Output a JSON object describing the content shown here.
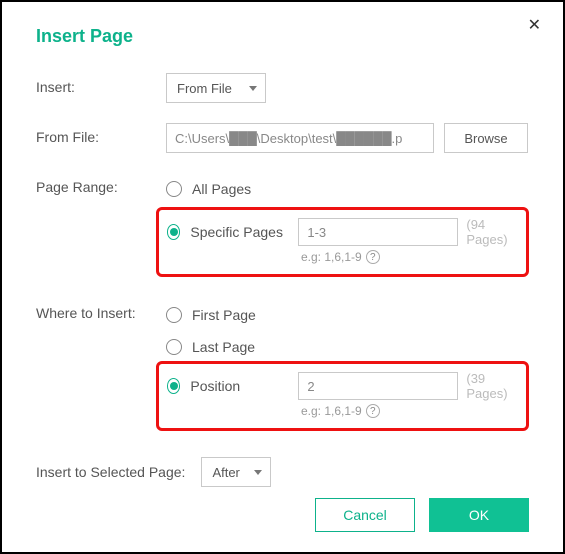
{
  "dialog": {
    "title": "Insert Page",
    "close": "✕"
  },
  "insert": {
    "label": "Insert:",
    "value": "From File"
  },
  "from_file": {
    "label": "From File:",
    "path": "C:\\Users\\███\\Desktop\\test\\██████.p",
    "browse": "Browse"
  },
  "page_range": {
    "label": "Page Range:",
    "all_label": "All Pages",
    "specific_label": "Specific Pages",
    "specific_value": "1-3",
    "specific_total": "(94 Pages)",
    "hint": "e.g: 1,6,1-9"
  },
  "where": {
    "label": "Where to Insert:",
    "first_label": "First Page",
    "last_label": "Last Page",
    "position_label": "Position",
    "position_value": "2",
    "position_total": "(39 Pages)",
    "hint": "e.g: 1,6,1-9"
  },
  "insert_to": {
    "label": "Insert to Selected Page:",
    "value": "After"
  },
  "footer": {
    "cancel": "Cancel",
    "ok": "OK"
  }
}
